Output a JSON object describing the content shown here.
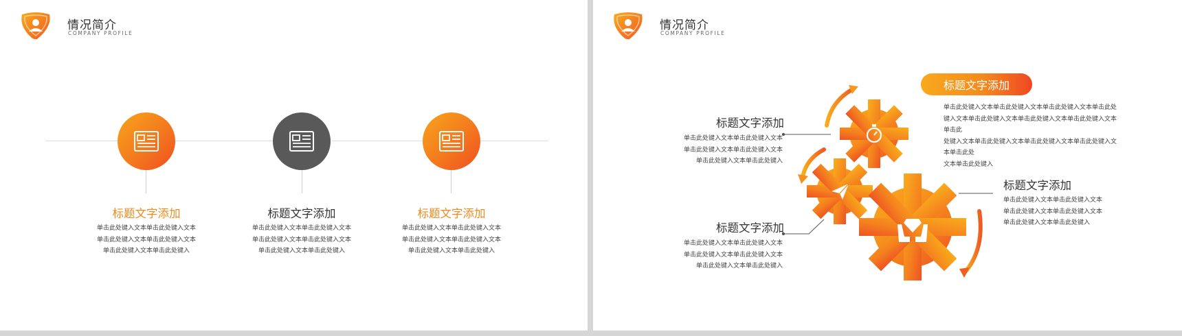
{
  "left_slide": {
    "header": {
      "title": "情况简介",
      "subtitle": "COMPANY  PROFILE"
    },
    "columns": [
      {
        "title": "标题文字添加",
        "lines": [
          "单击此处键入文本单击此处键入文本",
          "单击此处键入文本单击此处键入文本",
          "单击此处键入文本单击此处键入"
        ]
      },
      {
        "title": "标题文字添加",
        "lines": [
          "单击此处键入文本单击此处键入文本",
          "单击此处键入文本单击此处键入文本",
          "单击此处键入文本单击此处键入"
        ]
      },
      {
        "title": "标题文字添加",
        "lines": [
          "单击此处键入文本单击此处键入文本",
          "单击此处键入文本单击此处键入文本",
          "单击此处键入文本单击此处键入"
        ]
      }
    ]
  },
  "right_slide": {
    "header": {
      "title": "情况简介",
      "subtitle": "COMPANY  PROFILE"
    },
    "top_left": {
      "title": "标题文字添加",
      "lines": [
        "单击此处键入文本单击此处键入文本",
        "单击此处键入文本单击此处键入文本",
        "单击此处键入文本单击此处键入"
      ]
    },
    "bottom_left": {
      "title": "标题文字添加",
      "lines": [
        "单击此处键入文本单击此处键入文本",
        "单击此处键入文本单击此处键入文本",
        "单击此处键入文本单击此处键入"
      ]
    },
    "top_right": {
      "title": "标题文字添加",
      "lines": [
        "单击此处键入文本单击此处键入文本单击此处键入文本单击此处",
        "键入文本单击此处键入文本单击此处键入文本单击此处键入文本单击此",
        "处键入文本单击此处键入文本单击此处键入文本单击此处键入文本单击此处",
        "文本单击此处键入"
      ]
    },
    "bottom_right": {
      "title": "标题文字添加",
      "lines": [
        "单击此处键入文本单击此处键入文本",
        "单击此处键入文本单击此处键入文本",
        "单击此处键入文本单击此处键入"
      ]
    }
  },
  "colors": {
    "orange_light": "#f7a51c",
    "orange_mid": "#f4791e",
    "orange_red": "#ef4e22",
    "gray_dark": "#595959"
  },
  "icons": [
    "profile-badge-icon",
    "document-icon",
    "stopwatch-icon",
    "paper-plane-icon",
    "diamond-hands-icon",
    "circular-arrow-icon"
  ]
}
